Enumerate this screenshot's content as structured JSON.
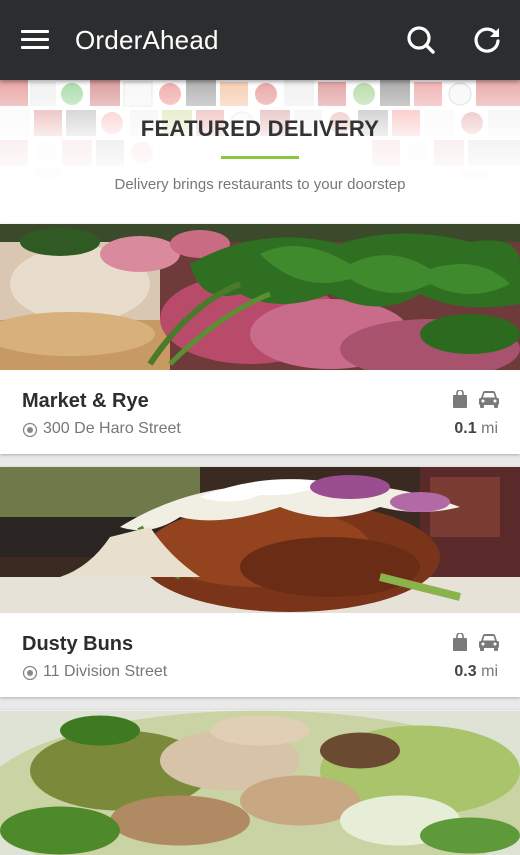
{
  "app": {
    "title": "OrderAhead",
    "menu_icon": "hamburger-menu-icon",
    "search_icon": "search-icon",
    "refresh_icon": "refresh-icon"
  },
  "featured": {
    "title": "FEATURED DELIVERY",
    "subtitle": "Delivery brings restaurants to your doorstep",
    "accent_color": "#8cc63f"
  },
  "restaurants": [
    {
      "name": "Market & Rye",
      "address": "300 De Haro Street",
      "distance_value": "0.1",
      "distance_unit": "mi",
      "icons": [
        "bag-icon",
        "car-icon"
      ]
    },
    {
      "name": "Dusty Buns",
      "address": "11 Division Street",
      "distance_value": "0.3",
      "distance_unit": "mi",
      "icons": [
        "bag-icon",
        "car-icon"
      ]
    },
    {
      "name": "",
      "address": "",
      "distance_value": "",
      "distance_unit": "",
      "icons": []
    }
  ]
}
